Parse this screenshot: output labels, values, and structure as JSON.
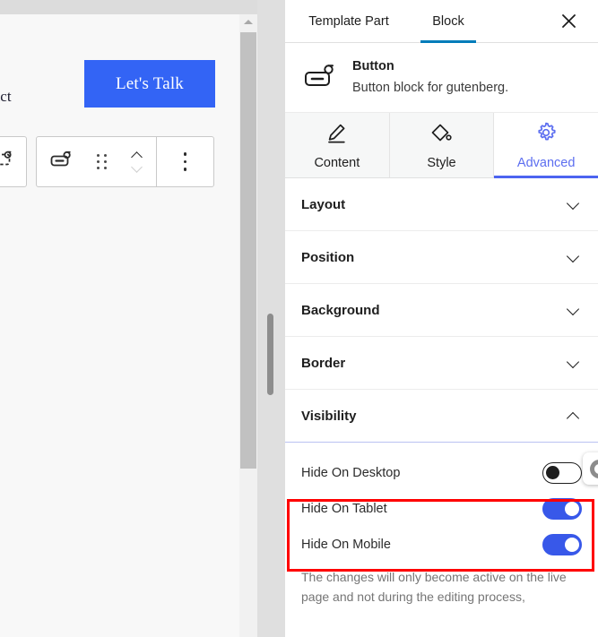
{
  "canvas": {
    "partial_text": "tact",
    "cta_label": "Let's Talk",
    "toolbar": {
      "parent_block_icon": "template-part-icon",
      "block_type_icon": "button-block-icon",
      "drag_handle_icon": "drag-handle-icon",
      "move_up_icon": "chevron-up-icon",
      "move_down_icon": "chevron-down-icon",
      "more_options_icon": "more-options-icon"
    }
  },
  "panel": {
    "top_tabs": [
      {
        "label": "Template Part",
        "active": false
      },
      {
        "label": "Block",
        "active": true
      }
    ],
    "close_icon": "close-icon",
    "block_info": {
      "icon": "button-block-icon",
      "title": "Button",
      "description": "Button block for gutenberg."
    },
    "sub_tabs": [
      {
        "label": "Content",
        "icon": "pencil-icon",
        "active": false
      },
      {
        "label": "Style",
        "icon": "style-droplet-icon",
        "active": false
      },
      {
        "label": "Advanced",
        "icon": "gear-icon",
        "active": true
      }
    ],
    "sections": [
      {
        "label": "Layout",
        "expanded": false,
        "chevron": "chevron-down-icon"
      },
      {
        "label": "Position",
        "expanded": false,
        "chevron": "chevron-down-icon"
      },
      {
        "label": "Background",
        "expanded": false,
        "chevron": "chevron-down-icon"
      },
      {
        "label": "Border",
        "expanded": false,
        "chevron": "chevron-down-icon"
      },
      {
        "label": "Visibility",
        "expanded": true,
        "chevron": "chevron-up-icon"
      }
    ],
    "visibility": {
      "toggles": [
        {
          "label": "Hide On Desktop",
          "on": false
        },
        {
          "label": "Hide On Tablet",
          "on": true
        },
        {
          "label": "Hide On Mobile",
          "on": true
        }
      ],
      "help_text": "The changes will only become active on the live page and not during the editing process,"
    }
  },
  "colors": {
    "accent_blue": "#3858e9",
    "tab_underline": "#007cba",
    "advanced_blue": "#5c6ef0",
    "cta_blue": "#3364f5",
    "annotation_red": "#ff0000"
  }
}
